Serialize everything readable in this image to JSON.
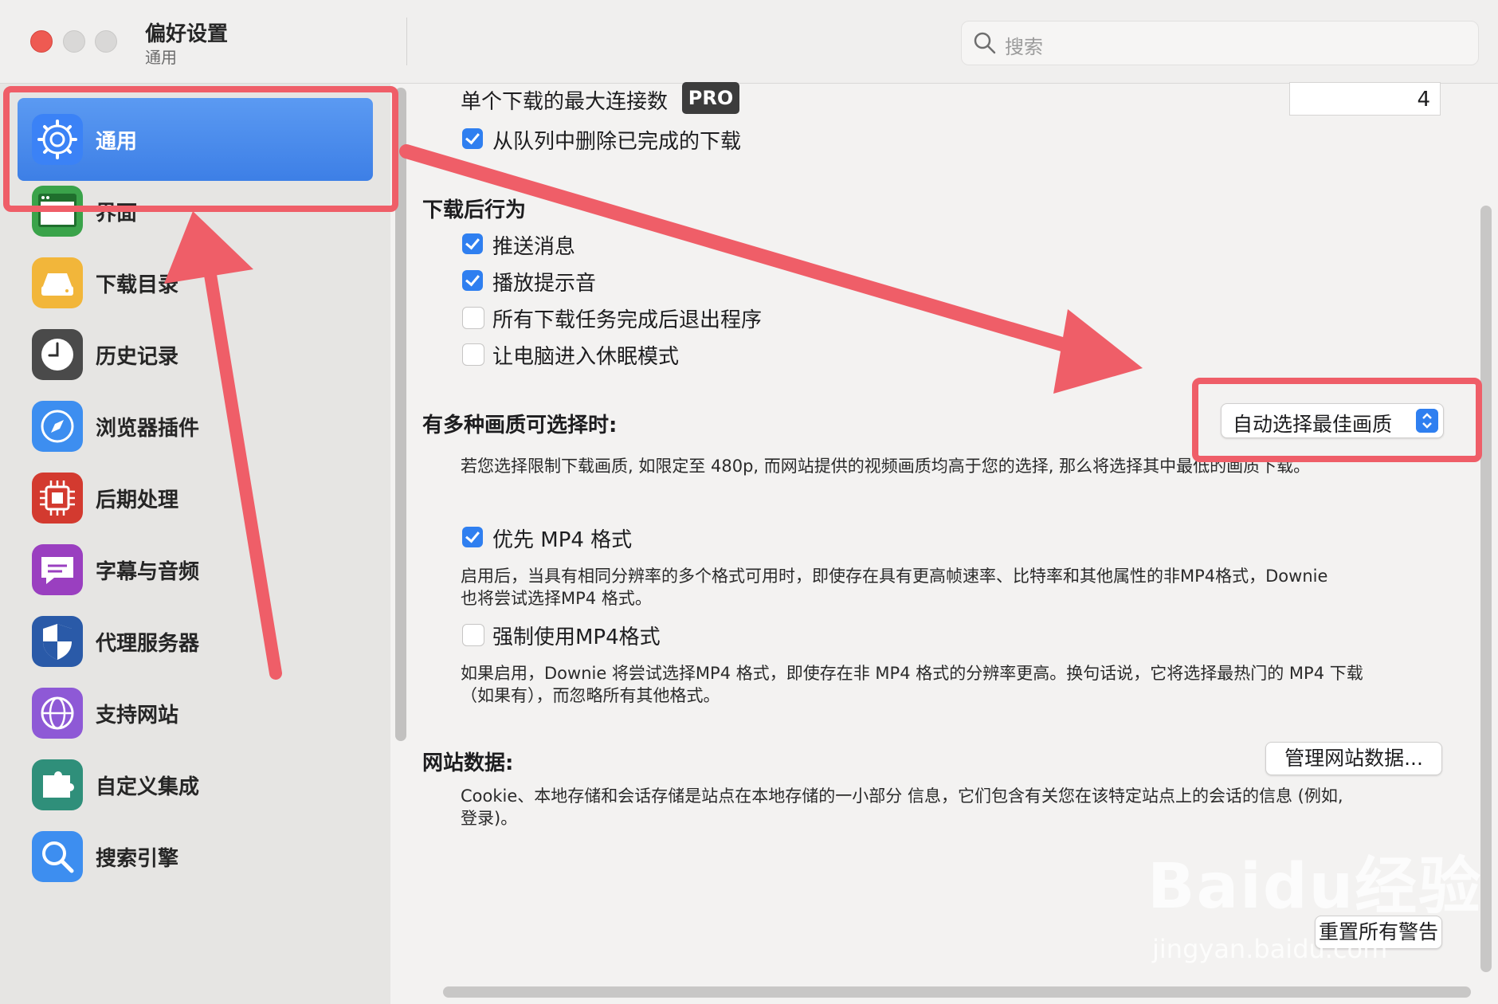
{
  "window": {
    "title": "偏好设置",
    "subtitle": "通用",
    "search_placeholder": "搜索"
  },
  "sidebar": {
    "items": [
      {
        "label": "通用",
        "icon": "gear-icon",
        "color": "#3b82f6"
      },
      {
        "label": "界面",
        "icon": "window-icon",
        "color": "#3aa34a"
      },
      {
        "label": "下载目录",
        "icon": "drive-icon",
        "color": "#f2b63a"
      },
      {
        "label": "历史记录",
        "icon": "clock-icon",
        "color": "#4a4a4a"
      },
      {
        "label": "浏览器插件",
        "icon": "compass-icon",
        "color": "#3d8ef0"
      },
      {
        "label": "后期处理",
        "icon": "chip-icon",
        "color": "#d33a2f"
      },
      {
        "label": "字幕与音频",
        "icon": "chat-icon",
        "color": "#9a3fc0"
      },
      {
        "label": "代理服务器",
        "icon": "shield-icon",
        "color": "#2a5aa8"
      },
      {
        "label": "支持网站",
        "icon": "globe-icon",
        "color": "#8e59d6"
      },
      {
        "label": "自定义集成",
        "icon": "puzzle-icon",
        "color": "#2f8f7a"
      },
      {
        "label": "搜索引擎",
        "icon": "search-icon",
        "color": "#3d8ef0"
      }
    ]
  },
  "content": {
    "max_connections_label": "单个下载的最大连接数",
    "pro_badge": "PRO",
    "max_connections_value": "4",
    "remove_completed_label": "从队列中删除已完成的下载",
    "after_download_heading": "下载后行为",
    "after_download_options": [
      {
        "label": "推送消息",
        "checked": true
      },
      {
        "label": "播放提示音",
        "checked": true
      },
      {
        "label": "所有下载任务完成后退出程序",
        "checked": false
      },
      {
        "label": "让电脑进入休眠模式",
        "checked": false
      }
    ],
    "quality_heading": "有多种画质可选择时:",
    "quality_value": "自动选择最佳画质",
    "quality_desc": "若您选择限制下载画质, 如限定至 480p, 而网站提供的视频画质均高于您的选择, 那么将选择其中最低的画质下载。",
    "prefer_mp4_label": "优先 MP4 格式",
    "prefer_mp4_checked": true,
    "prefer_mp4_desc_line1": "启用后，当具有相同分辨率的多个格式可用时，即使存在具有更高帧速率、比特率和其他属性的非MP4格式，Downie",
    "prefer_mp4_desc_line2": "也将尝试选择MP4 格式。",
    "force_mp4_label": "强制使用MP4格式",
    "force_mp4_checked": false,
    "force_mp4_desc_line1": "如果启用，Downie 将尝试选择MP4 格式，即使存在非 MP4 格式的分辨率更高。换句话说，它将选择最热门的 MP4 下载",
    "force_mp4_desc_line2": "（如果有），而忽略所有其他格式。",
    "website_data_heading": "网站数据:",
    "manage_website_data_button": "管理网站数据...",
    "website_data_desc_line1": "Cookie、本地存储和会话存储是站点在本地存储的一小部分 信息，它们包含有关您在该特定站点上的会话的信息 (例如,",
    "website_data_desc_line2": "登录)。",
    "reset_warnings_button": "重置所有警告"
  },
  "watermark": {
    "brand": "Baidu经验",
    "url": "jingyan.baidu.com"
  },
  "colors": {
    "accent": "#2f7ff0",
    "annotation": "#ef5e68",
    "sidebar_active": "#4a8cee"
  }
}
